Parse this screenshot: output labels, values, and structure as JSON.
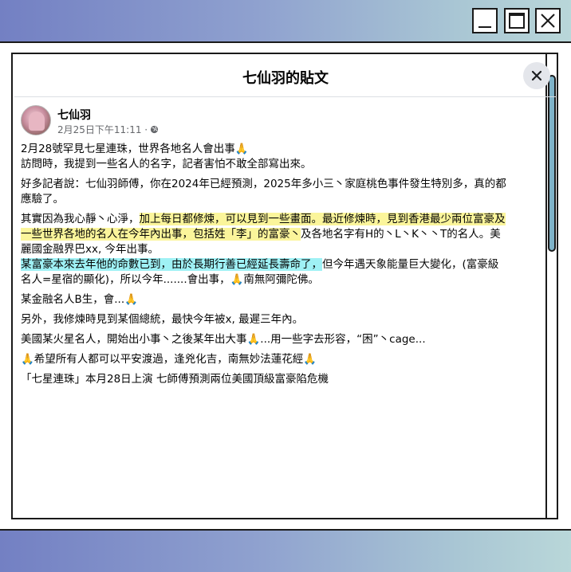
{
  "post": {
    "title": "七仙羽的貼文",
    "author": "七仙羽",
    "timestamp": "2月25日下午11:11 ·",
    "paragraphs": [
      [
        "2月28號罕見七星連珠，世界各地名人會出事🙏",
        "訪問時，我提到一些名人的名字，記者害怕不敢全部寫出來。"
      ],
      [
        "好多記者說：七仙羽師傅，你在2024年已經預測，2025年多小三丶家庭桃色事件發生特別多，真的都",
        "應驗了。"
      ]
    ],
    "p3": {
      "a": "其實因為我心靜丶心淨，",
      "b": "加上每日都修煉，可以見到一些畫面。最近修煉時，見到香港最少兩位富豪及",
      "c": "一些世界各地的名人在今年內出事，包括姓「李」的富豪丶",
      "d": "及各地名字有H的丶L丶K丶丶T的名人。美",
      "e": "麗國金融界巴xx, 今年出事。",
      "f": "某富豪本來去年他的命數已到，由於長期行善已經延長壽命了，",
      "g": "但今年遇天象能量巨大變化，(富豪級",
      "h": "名人=星宿的顯化)，所以今年.......會出事，🙏南無阿彌陀佛。"
    },
    "tail_paragraphs": [
      "某金融名人B生，會...🙏",
      "另外，我修煉時見到某個總統，最快今年被x, 最遲三年內。",
      "美國某火星名人，開始出小事丶之後某年出大事🙏...用一些字去形容，“困”丶cage...",
      "🙏希望所有人都可以平安渡過，逢兇化吉，南無妙法蓮花經🙏",
      "「七星連珠」本月28日上演  七師傅預測兩位美國頂級富豪陷危機"
    ]
  },
  "colors": {
    "highlight_yellow": "#fbf59b",
    "highlight_cyan": "#9ff1f5",
    "window_gradient_start": "#7380c3",
    "window_gradient_end": "#b9d7d9",
    "scroll_thumb": "#7fb3c9"
  }
}
